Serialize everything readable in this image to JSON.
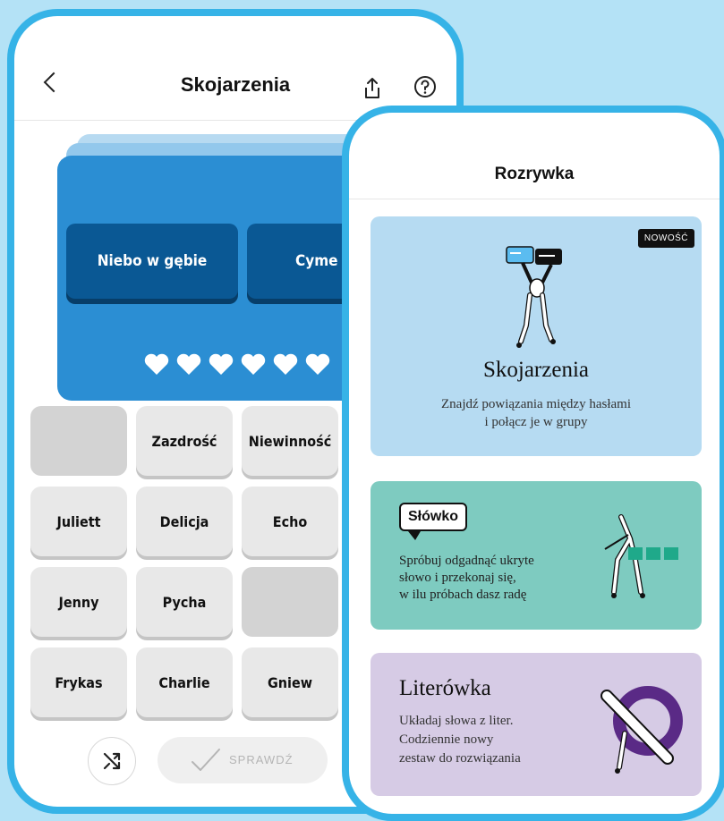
{
  "phone1": {
    "header": {
      "title": "Skojarzenia"
    },
    "solved_groups": [
      "Niebo w gębie",
      "Cyme"
    ],
    "lives": 6,
    "tiles": [
      {
        "label": ""
      },
      {
        "label": "Zazdrość"
      },
      {
        "label": "Niewinność"
      },
      {
        "label": "Juliett"
      },
      {
        "label": "Delicja"
      },
      {
        "label": "Echo"
      },
      {
        "label": "Jenny"
      },
      {
        "label": "Pycha"
      },
      {
        "label": ""
      },
      {
        "label": "Frykas"
      },
      {
        "label": "Charlie"
      },
      {
        "label": "Gniew"
      }
    ],
    "check_label": "SPRAWDŹ"
  },
  "phone2": {
    "header": {
      "title": "Rozrywka"
    },
    "cards": [
      {
        "badge": "NOWOŚĆ",
        "title": "Skojarzenia",
        "desc_line1": "Znajdź powiązania między hasłami",
        "desc_line2": "i połącz je w grupy",
        "bg": "#b6dbf2"
      },
      {
        "logo": "Słówko",
        "desc_line1": "Spróbuj odgadnąć ukryte",
        "desc_line2": "słowo i przekonaj się,",
        "desc_line3": "w ilu próbach dasz radę",
        "bg": "#7ecbc0"
      },
      {
        "title": "Literówka",
        "desc_line1": "Układaj słowa z liter.",
        "desc_line2": "Codziennie nowy",
        "desc_line3": "zestaw do rozwiązania",
        "bg": "#d6cbe5"
      }
    ]
  },
  "colors": {
    "frame": "#36b3e7",
    "background": "#b4e2f6",
    "board": "#2b8ed3",
    "solved_card": "#0a5894"
  }
}
